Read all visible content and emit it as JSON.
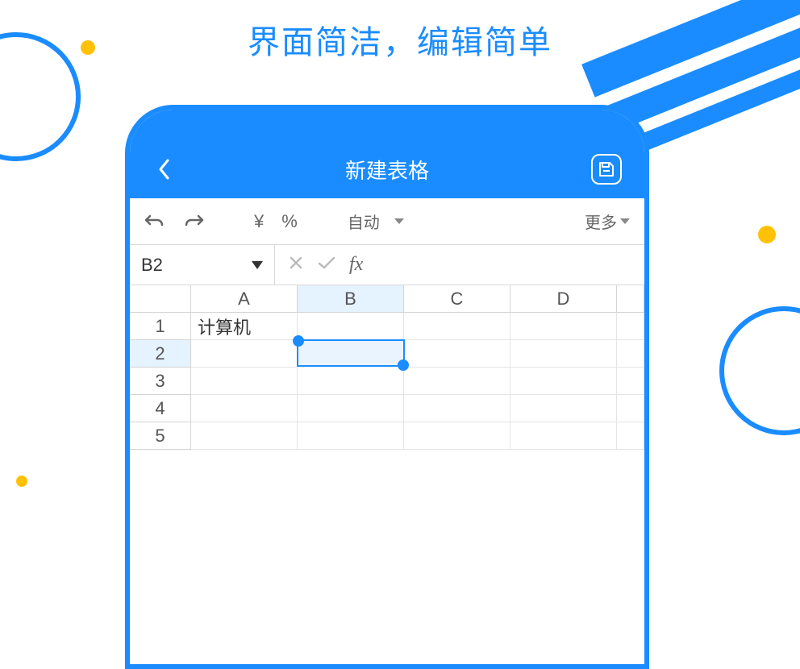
{
  "headline": "界面简洁，编辑简单",
  "app": {
    "title": "新建表格",
    "back_icon": "back-chevron",
    "save_icon": "save-icon"
  },
  "toolbar": {
    "undo_icon": "undo",
    "redo_icon": "redo",
    "currency_label": "¥",
    "percent_label": "%",
    "auto_label": "自动",
    "more_label": "更多"
  },
  "formula_bar": {
    "cell_ref": "B2",
    "cancel_icon": "x",
    "confirm_icon": "check",
    "fx_label": "fx"
  },
  "grid": {
    "columns": [
      "A",
      "B",
      "C",
      "D"
    ],
    "rows": [
      "1",
      "2",
      "3",
      "4",
      "5"
    ],
    "selected_column": "B",
    "selected_row": "2",
    "cells": {
      "A1": "计算机"
    },
    "selection": "B2"
  },
  "colors": {
    "brand": "#1a8cff",
    "accent": "#ffc107"
  }
}
